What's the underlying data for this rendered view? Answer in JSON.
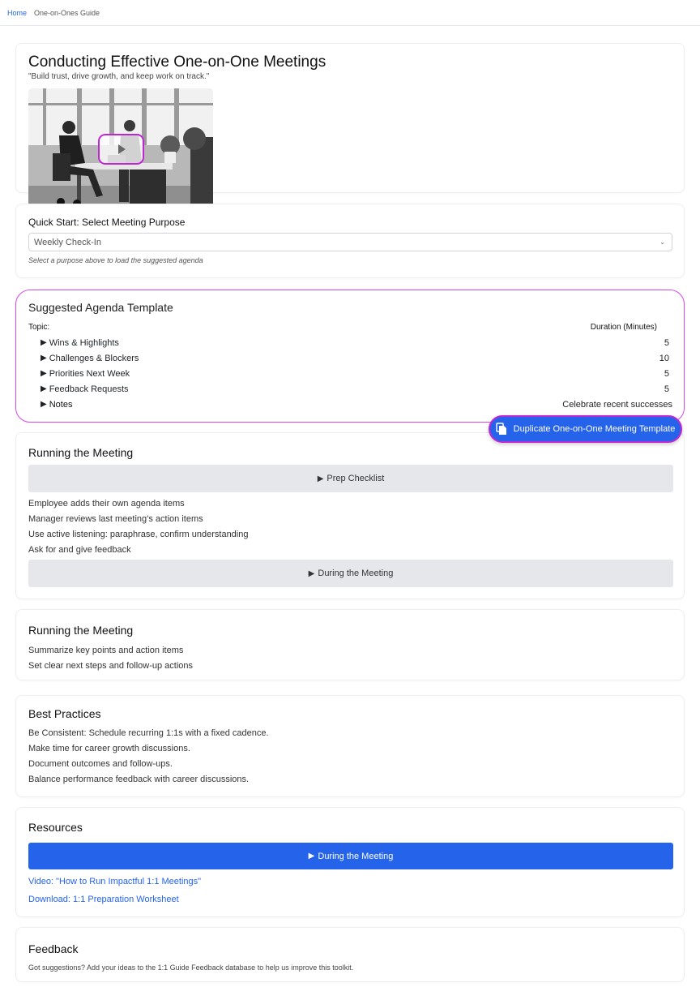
{
  "breadcrumb": {
    "home": "Home",
    "current": "One-on-Ones Guide"
  },
  "hero": {
    "title": "Conducting Effective One-on-One Meetings",
    "quote": "\"Build trust, drive growth, and keep work on track.\""
  },
  "quick_start": {
    "label": "Quick Start: Select Meeting Purpose",
    "selected": "Weekly Check-In",
    "help": "Select a purpose above to load the suggested agenda"
  },
  "agenda": {
    "title": "Suggested Agenda Template",
    "topic_header": "Topic:",
    "duration_header": "Duration (Minutes)",
    "rows": [
      {
        "topic": "Wins & Highlights",
        "value": "5"
      },
      {
        "topic": "Challenges & Blockers",
        "value": "10"
      },
      {
        "topic": "Priorities Next Week",
        "value": "5"
      },
      {
        "topic": "Feedback Requests",
        "value": "5"
      },
      {
        "topic": "Notes",
        "value": "Celebrate recent successes"
      }
    ],
    "duplicate_label": "Duplicate One-on-One Meeting Template"
  },
  "running1": {
    "title": "Running the Meeting",
    "prep_label": "Prep Checklist",
    "items": [
      "Employee adds their own agenda items",
      "Manager reviews last meeting’s action items",
      "Use active listening: paraphrase, confirm understanding",
      "Ask for and give feedback"
    ],
    "during_label": "During the Meeting"
  },
  "running2": {
    "title": "Running the Meeting",
    "items": [
      "Summarize key points and action items",
      "Set clear next steps and follow-up actions"
    ]
  },
  "best": {
    "title": "Best Practices",
    "items": [
      "Be Consistent: Schedule recurring 1:1s with a fixed cadence.",
      "Make time for career growth discussions.",
      "Document outcomes and follow-ups.",
      "Balance performance feedback with career discussions."
    ]
  },
  "resources": {
    "title": "Resources",
    "button_label": "During the Meeting",
    "links": [
      "Video: \"How to Run Impactful 1:1 Meetings\"",
      "Download: 1:1 Preparation Worksheet"
    ]
  },
  "feedback": {
    "title": "Feedback",
    "text": "Got suggestions? Add your ideas to the 1:1 Guide Feedback database to help us improve this toolkit."
  },
  "colors": {
    "accent": "#2563eb",
    "highlight": "#d946ef"
  }
}
